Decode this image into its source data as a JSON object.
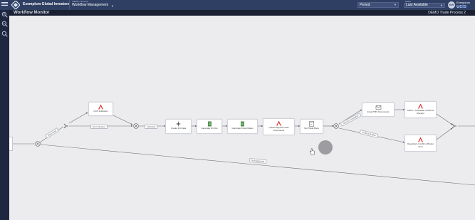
{
  "header": {
    "brand": "Exemplum Global Investors",
    "module_caption": "VIEWS / Screens",
    "module_value": "Workflow Management",
    "period_value": "Period",
    "dates_caption": "Dates",
    "dates_value": "Last Available",
    "avatar_initials": "KW",
    "user_small": "Exemplum",
    "user_logo": "ucis"
  },
  "subheader": {
    "title": "Workflow Monitor",
    "process": "DEMO Trade Process 2"
  },
  "rail": {
    "icons": [
      "zoom-in-icon",
      "zoom-out-icon",
      "search-icon"
    ]
  },
  "nodes": [
    {
      "id": "cco",
      "label": "CCO Indication",
      "icon": "acrobat-icon"
    },
    {
      "id": "create_fix",
      "label": "Create Fix Data",
      "icon": "sparkle-icon"
    },
    {
      "id": "generate_fix",
      "label": "Generate Fix File",
      "icon": "document-icon"
    },
    {
      "id": "generate_trade",
      "label": "Generate Trade Model",
      "icon": "document-icon"
    },
    {
      "id": "upload_signed",
      "label": "Upload Signed Trade Documents",
      "icon": "acrobat-icon"
    },
    {
      "id": "set_trade",
      "label": "Set Trade Book",
      "icon": "form-icon"
    },
    {
      "id": "email_tms",
      "label": "Email TMS Documents",
      "icon": "email-icon"
    },
    {
      "id": "admin_custodian",
      "label": "Admin / Custodian Confirms Receipt",
      "icon": "acrobat-icon"
    },
    {
      "id": "ops_confirms",
      "label": "Operations Confirms Broker Sent",
      "icon": "acrobat-icon"
    }
  ],
  "edge_labels": {
    "auto_send": "Auto-send",
    "not_indicated": "Not Indicated",
    "indicated": "Indicated",
    "send_to_custodian": "Send to Custodian",
    "send_to_broker": "Send to Broker",
    "not_approved": "Not Approved"
  }
}
